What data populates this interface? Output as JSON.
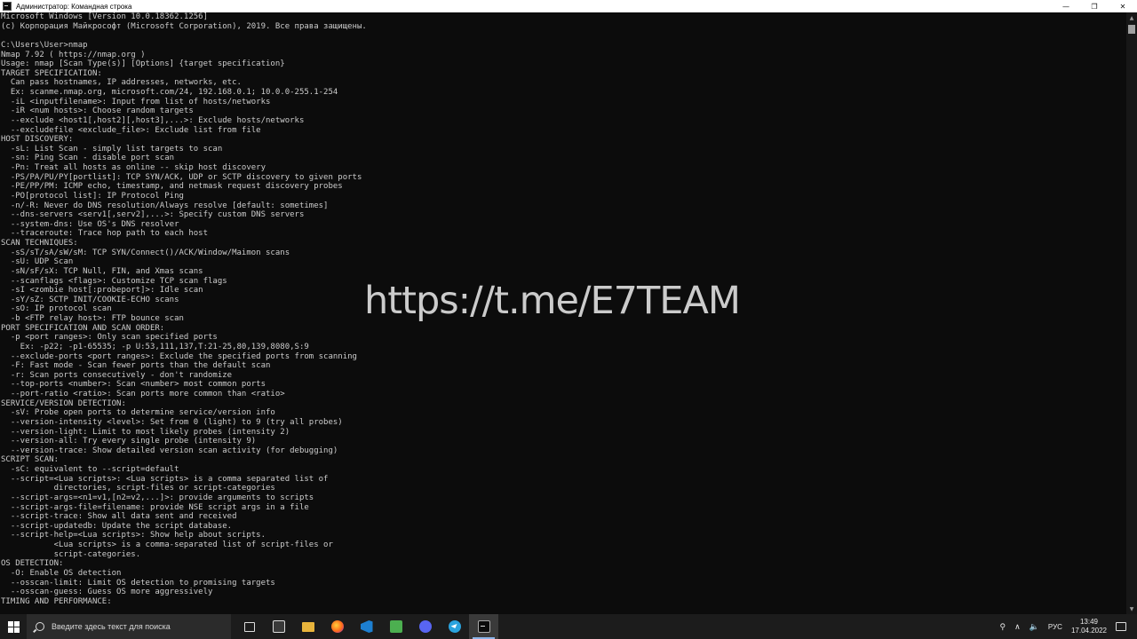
{
  "window": {
    "title": "Администратор: Командная строка",
    "controls": {
      "minimize": "—",
      "maximize": "❐",
      "close": "✕"
    }
  },
  "console": {
    "lines": [
      "Microsoft Windows [Version 10.0.18362.1256]",
      "(c) Корпорация Майкрософт (Microsoft Corporation), 2019. Все права защищены.",
      "",
      "C:\\Users\\User>nmap",
      "Nmap 7.92 ( https://nmap.org )",
      "Usage: nmap [Scan Type(s)] [Options] {target specification}",
      "TARGET SPECIFICATION:",
      "  Can pass hostnames, IP addresses, networks, etc.",
      "  Ex: scanme.nmap.org, microsoft.com/24, 192.168.0.1; 10.0.0-255.1-254",
      "  -iL <inputfilename>: Input from list of hosts/networks",
      "  -iR <num hosts>: Choose random targets",
      "  --exclude <host1[,host2][,host3],...>: Exclude hosts/networks",
      "  --excludefile <exclude_file>: Exclude list from file",
      "HOST DISCOVERY:",
      "  -sL: List Scan - simply list targets to scan",
      "  -sn: Ping Scan - disable port scan",
      "  -Pn: Treat all hosts as online -- skip host discovery",
      "  -PS/PA/PU/PY[portlist]: TCP SYN/ACK, UDP or SCTP discovery to given ports",
      "  -PE/PP/PM: ICMP echo, timestamp, and netmask request discovery probes",
      "  -PO[protocol list]: IP Protocol Ping",
      "  -n/-R: Never do DNS resolution/Always resolve [default: sometimes]",
      "  --dns-servers <serv1[,serv2],...>: Specify custom DNS servers",
      "  --system-dns: Use OS's DNS resolver",
      "  --traceroute: Trace hop path to each host",
      "SCAN TECHNIQUES:",
      "  -sS/sT/sA/sW/sM: TCP SYN/Connect()/ACK/Window/Maimon scans",
      "  -sU: UDP Scan",
      "  -sN/sF/sX: TCP Null, FIN, and Xmas scans",
      "  --scanflags <flags>: Customize TCP scan flags",
      "  -sI <zombie host[:probeport]>: Idle scan",
      "  -sY/sZ: SCTP INIT/COOKIE-ECHO scans",
      "  -sO: IP protocol scan",
      "  -b <FTP relay host>: FTP bounce scan",
      "PORT SPECIFICATION AND SCAN ORDER:",
      "  -p <port ranges>: Only scan specified ports",
      "    Ex: -p22; -p1-65535; -p U:53,111,137,T:21-25,80,139,8080,S:9",
      "  --exclude-ports <port ranges>: Exclude the specified ports from scanning",
      "  -F: Fast mode - Scan fewer ports than the default scan",
      "  -r: Scan ports consecutively - don't randomize",
      "  --top-ports <number>: Scan <number> most common ports",
      "  --port-ratio <ratio>: Scan ports more common than <ratio>",
      "SERVICE/VERSION DETECTION:",
      "  -sV: Probe open ports to determine service/version info",
      "  --version-intensity <level>: Set from 0 (light) to 9 (try all probes)",
      "  --version-light: Limit to most likely probes (intensity 2)",
      "  --version-all: Try every single probe (intensity 9)",
      "  --version-trace: Show detailed version scan activity (for debugging)",
      "SCRIPT SCAN:",
      "  -sC: equivalent to --script=default",
      "  --script=<Lua scripts>: <Lua scripts> is a comma separated list of",
      "           directories, script-files or script-categories",
      "  --script-args=<n1=v1,[n2=v2,...]>: provide arguments to scripts",
      "  --script-args-file=filename: provide NSE script args in a file",
      "  --script-trace: Show all data sent and received",
      "  --script-updatedb: Update the script database.",
      "  --script-help=<Lua scripts>: Show help about scripts.",
      "           <Lua scripts> is a comma-separated list of script-files or",
      "           script-categories.",
      "OS DETECTION:",
      "  -O: Enable OS detection",
      "  --osscan-limit: Limit OS detection to promising targets",
      "  --osscan-guess: Guess OS more aggressively",
      "TIMING AND PERFORMANCE:"
    ]
  },
  "watermark": {
    "text": "https://t.me/E7TEAM"
  },
  "taskbar": {
    "search_placeholder": "Введите здесь текст для поиска",
    "tray": {
      "language": "РУС",
      "time": "13:49",
      "date": "17.04.2022",
      "chevron": "∧",
      "speaker": "🔈"
    }
  }
}
